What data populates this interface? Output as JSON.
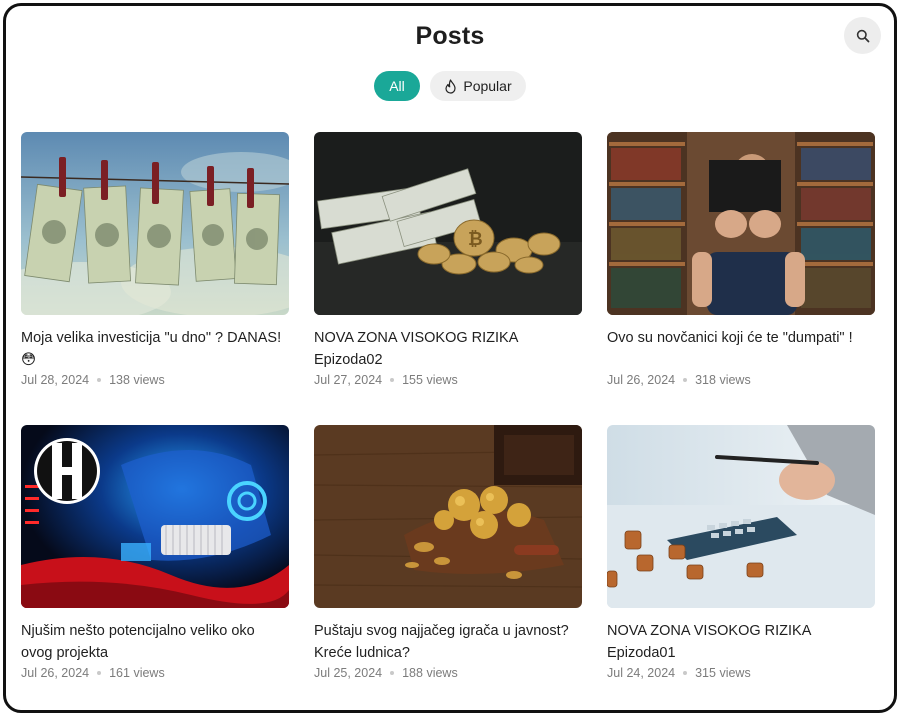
{
  "header": {
    "title": "Posts",
    "search_icon": "search-icon"
  },
  "tabs": [
    {
      "label": "All",
      "active": true
    },
    {
      "label": "Popular",
      "icon": "flame-icon",
      "active": false
    }
  ],
  "colors": {
    "accent": "#1aa898",
    "tab_inactive_bg": "#efefef",
    "meta_text": "#7c7c7c"
  },
  "posts": [
    {
      "title": "Moja velika investicija \"u dno\" ? DANAS! 😳",
      "date": "Jul 28, 2024",
      "views": "138 views",
      "image": "dollar-bills-on-clothesline"
    },
    {
      "title": "NOVA ZONA VISOKOG RIZIKA Epizoda02",
      "date": "Jul 27, 2024",
      "views": "155 views",
      "image": "bitcoin-coins-and-cash"
    },
    {
      "title": "Ovo su novčanici koji će te \"dumpati\" !",
      "date": "Jul 26, 2024",
      "views": "318 views",
      "image": "man-with-book-in-library"
    },
    {
      "title": "Njušim nešto potencijalno veliko oko ovog projekta",
      "date": "Jul 26, 2024",
      "views": "161 views",
      "image": "neon-h-logo"
    },
    {
      "title": "Puštaju svog najjačeg igrača u javnost? Kreće ludnica?",
      "date": "Jul 25, 2024",
      "views": "188 views",
      "image": "treasure-chest-gold"
    },
    {
      "title": "NOVA ZONA VISOKOG RIZIKA Epizoda01",
      "date": "Jul 24, 2024",
      "views": "315 views",
      "image": "calculator-and-coins"
    }
  ]
}
